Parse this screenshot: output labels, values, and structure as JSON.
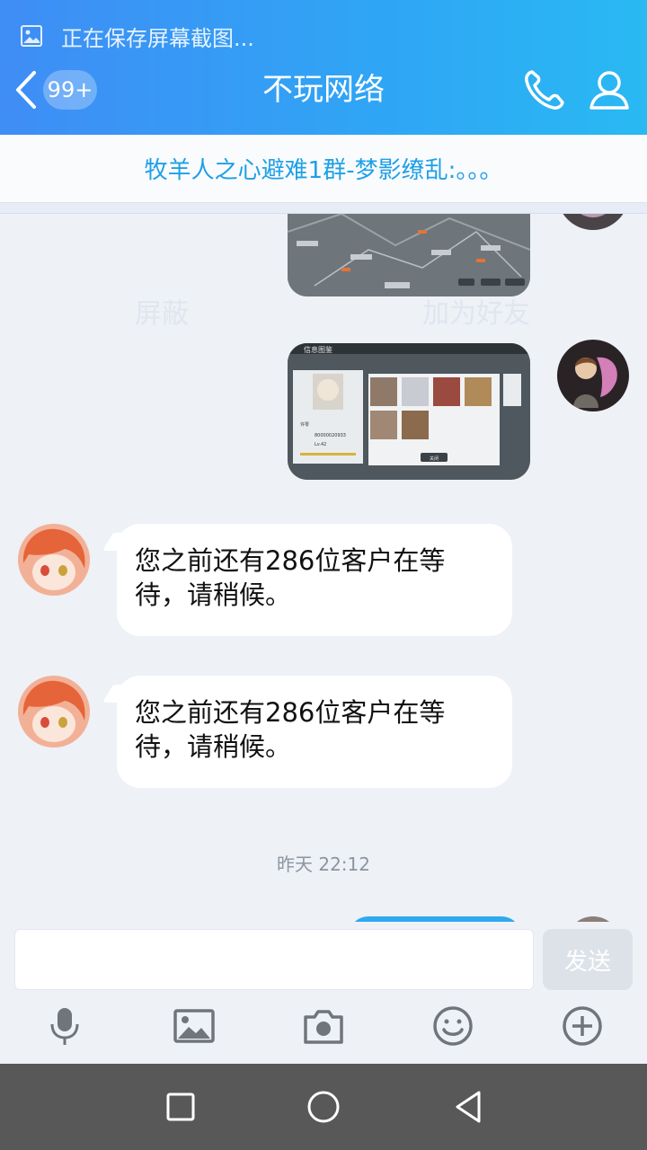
{
  "header": {
    "screenshot_notice": "正在保存屏幕截图...",
    "unread_badge": "99+",
    "title": "不玩网络"
  },
  "banner": {
    "text": "牧羊人之心避难1群-梦影缭乱:。。。",
    "ghost_left": "屏蔽",
    "ghost_right": "加为好友"
  },
  "messages": [
    {
      "type": "image",
      "side": "right",
      "content": "game map screenshot"
    },
    {
      "type": "image",
      "side": "right",
      "content": "game info card screenshot",
      "labels": {
        "header": "信息图鉴",
        "name": "许零",
        "id": "80000020933",
        "level": "Lv.42",
        "button": "关闭"
      }
    },
    {
      "type": "text",
      "side": "left",
      "text": "您之前还有286位客户在等待，请稍候。"
    },
    {
      "type": "text",
      "side": "left",
      "text": "您之前还有286位客户在等待，请稍候。"
    }
  ],
  "timestamp": "昨天 22:12",
  "input": {
    "value": "",
    "send_label": "发送"
  },
  "toolbar": [
    "microphone-icon",
    "image-icon",
    "camera-icon",
    "emoji-icon",
    "plus-icon"
  ],
  "colors": {
    "header_start": "#3f8df5",
    "header_end": "#29b9f3",
    "banner_text": "#1ea0e8",
    "background": "#eef1f6",
    "send_disabled": "#dde2e9",
    "icon_gray": "#70757c"
  }
}
